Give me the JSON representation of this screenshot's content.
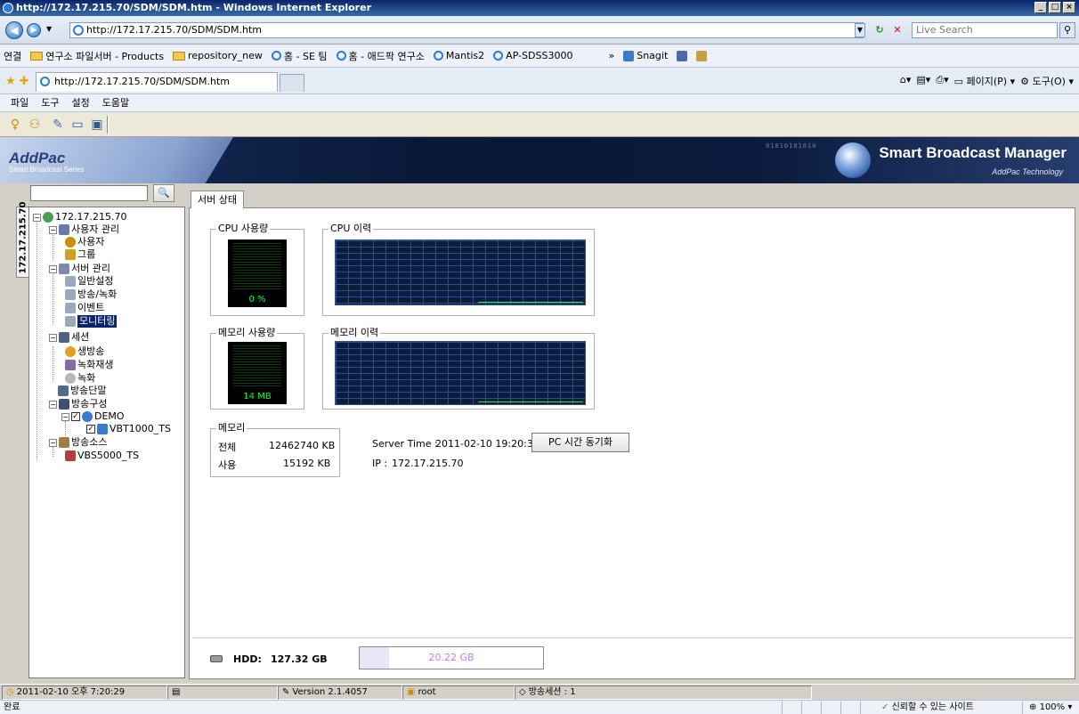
{
  "browser": {
    "title": "http://172.17.215.70/SDM/SDM.htm - Windows Internet Explorer",
    "url": "http://172.17.215.70/SDM/SDM.htm",
    "search_placeholder": "Live Search",
    "tab_title": "http://172.17.215.70/SDM/SDM.htm",
    "links_label": "연결",
    "links": [
      "연구소 파일서버 - Products",
      "repository_new",
      "홈 - SE 팀",
      "홈 - 애드팍 연구소",
      "Mantis2",
      "AP-SDSS3000"
    ],
    "links_more": "»",
    "snagit": "Snagit",
    "cmd_page": "페이지(P)",
    "cmd_tools": "도구(O)",
    "status_done": "완료",
    "status_trusted": "신뢰할 수 있는 사이트",
    "zoom": "100%"
  },
  "menu": [
    "파일",
    "도구",
    "설정",
    "도움말"
  ],
  "banner": {
    "logo": "AddPac",
    "logo_sub": "Smart Broadcast Series",
    "binary": "01010101010",
    "title": "Smart Broadcast Manager",
    "subtitle": "AddPac Technology"
  },
  "sidebar": {
    "vertical_tab": "172.17.215.70",
    "search_button": "🔍",
    "tree": {
      "root": "172.17.215.70",
      "user_mgmt": "사용자 관리",
      "user": "사용자",
      "group": "그룹",
      "server_mgmt": "서버 관리",
      "general": "일반설정",
      "broadcast_record": "방송/녹화",
      "event": "이벤트",
      "monitoring": "모니터링",
      "session": "세션",
      "live": "생방송",
      "replay": "녹화재생",
      "record": "녹화",
      "terminal": "방송단말",
      "config": "방송구성",
      "demo": "DEMO",
      "vbt": "VBT1000_TS",
      "source": "방송소스",
      "vbs": "VBS5000_TS"
    }
  },
  "main": {
    "tab": "서버 상태",
    "cpu_usage_label": "CPU 사용량",
    "cpu_history_label": "CPU 이력",
    "cpu_value": "0 %",
    "mem_usage_label": "메모리 사용량",
    "mem_history_label": "메모리 이력",
    "mem_value": "14 MB",
    "memory_label": "메모리",
    "total_label": "전체",
    "total_value": "12462740 KB",
    "used_label": "사용",
    "used_value": "15192 KB",
    "server_time_label": "Server Time :",
    "server_time_value": "2011-02-10 19:20:31",
    "sync_button": "PC 시간 동기화",
    "ip_label": "IP :",
    "ip_value": "172.17.215.70",
    "hdd_label": "HDD:",
    "hdd_total": "127.32 GB",
    "hdd_used": "20.22 GB",
    "hdd_used_fraction": 0.159
  },
  "app_status": {
    "datetime": "2011-02-10 오후 7:20:29",
    "version": "Version 2.1.4057",
    "user": "root",
    "sessions": "방송세션 : 1"
  }
}
